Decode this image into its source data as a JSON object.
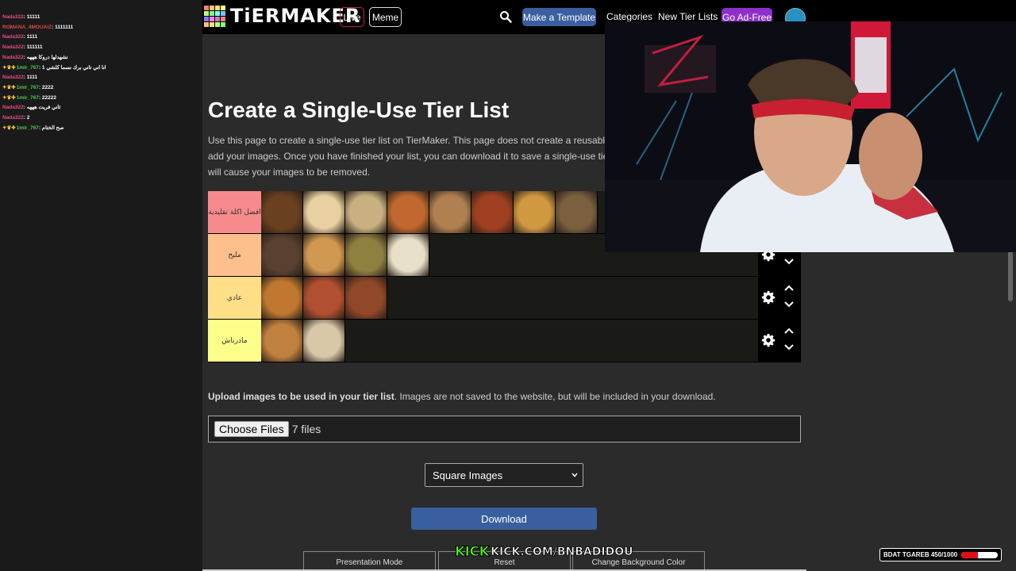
{
  "chat": {
    "messages": [
      {
        "user": "Nada322",
        "text": "11111",
        "badges": "",
        "color": "pink"
      },
      {
        "user": "ROMANA_4MOUAIZ",
        "text": "1111111",
        "badges": "",
        "color": "red"
      },
      {
        "user": "Nada322",
        "text": "1111",
        "badges": "",
        "color": "pink"
      },
      {
        "user": "Nada322",
        "text": "111111",
        "badges": "",
        "color": "pink"
      },
      {
        "user": "Nada322",
        "text": "نشهدلها دروكا هههه",
        "badges": "",
        "color": "pink"
      },
      {
        "user": "1mir_767",
        "text": "انا اني تاني برك نسما كلشي 1",
        "badges": "✦♛✚",
        "color": "green"
      },
      {
        "user": "Nada322",
        "text": "1111",
        "badges": "",
        "color": "pink"
      },
      {
        "user": "1mir_767",
        "text": "2222",
        "badges": "✦♛✚",
        "color": "green"
      },
      {
        "user": "1mir_767",
        "text": "22222",
        "badges": "✦♛✚",
        "color": "green"
      },
      {
        "user": "Nada322",
        "text": "ثاني فريت هههه",
        "badges": "",
        "color": "pink"
      },
      {
        "user": "Nada322",
        "text": "2",
        "badges": "",
        "color": "pink"
      },
      {
        "user": "1mir_767",
        "text": "صح الختام",
        "badges": "✦♛✚",
        "color": "green"
      }
    ]
  },
  "nav": {
    "logo_text": "TiERMAKER",
    "live_label": "Live",
    "meme_label": "Meme",
    "make_template_label": "Make a Template",
    "categories_label": "Categories",
    "new_lists_label": "New Tier Lists",
    "ad_free_label": "Go Ad-Free"
  },
  "page": {
    "title": "Create a Single-Use Tier List",
    "intro": "Use this page to create a single-use tier list on TierMaker. This page does not create a reusable template. Upload button below the tier list to add your images. Once you have finished your list, you can download it to save a single-use tier list to your profile page. Refreshing the page will cause your images to be removed."
  },
  "tiers": [
    {
      "label": "افضل اكلة تقليدية",
      "color": "#f78a8c",
      "items": [
        "#6a4020",
        "#e8d0a0",
        "#c8b080",
        "#c06830",
        "#b08050",
        "#a04020",
        "#d09840",
        "#7a6040"
      ]
    },
    {
      "label": "مليح",
      "color": "#fdbf8c",
      "items": [
        "#5a4030",
        "#d09850",
        "#908040",
        "#e8e0c8"
      ]
    },
    {
      "label": "عادي",
      "color": "#fedf88",
      "items": [
        "#c07830",
        "#b05030",
        "#904828"
      ]
    },
    {
      "label": "مادرناش",
      "color": "#fefe8a",
      "items": [
        "#c08040",
        "#d8c8a8"
      ]
    }
  ],
  "upload": {
    "bold_text": "Upload images to be used in your tier list",
    "rest_text": ". Images are not saved to the website, but will be included in your download.",
    "choose_label": "Choose Files",
    "files_count": "7 files"
  },
  "image_shape": {
    "selected": "Square Images"
  },
  "download_label": "Download",
  "bottom_buttons": {
    "presentation": "Presentation Mode",
    "reset": "Reset",
    "background": "Change Background Color"
  },
  "overlay": {
    "kick_logo": "KICK",
    "kick_url": "KICK.COM/BNBADIDOU",
    "goal_text": "BDAT TGAREB 450/1000",
    "goal_progress": 0.45
  }
}
